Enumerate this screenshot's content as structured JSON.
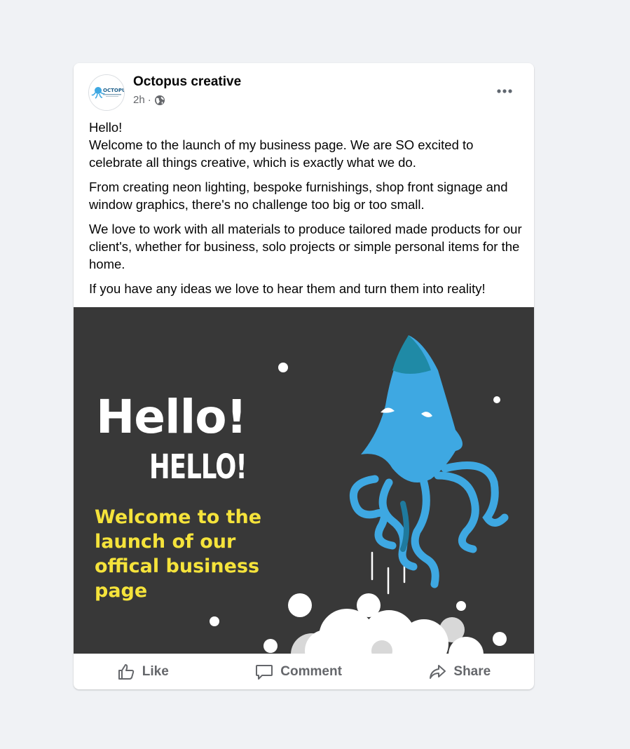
{
  "post": {
    "author": "Octopus creative",
    "avatar_text": "OCTOPUS",
    "time": "2h",
    "audience_icon": "globe-icon",
    "more_icon": "more-options-icon",
    "paragraphs": [
      "Hello!\nWelcome to the launch of my business page. We are SO excited to celebrate all things creative, which is exactly what we do.",
      "From creating neon lighting, bespoke furnishings, shop front signage and window graphics, there's no challenge too big or too small.",
      "We love to work with all materials to produce tailored made products for our client's, whether for business, solo projects or simple personal items for the home.",
      "If you have any ideas we love to hear them and turn them into reality!"
    ],
    "image": {
      "headline": "Hello!",
      "subheadline": "HELLO!",
      "tagline": "Welcome to the launch of our offical business page",
      "background_color": "#383838",
      "accent_color": "#f5e33b",
      "mascot": "octopus-rocket-illustration"
    }
  },
  "actions": {
    "like_label": "Like",
    "comment_label": "Comment",
    "share_label": "Share"
  },
  "colors": {
    "page_background": "#f0f2f5",
    "card_background": "#ffffff",
    "secondary_text": "#65676b",
    "octopus_blue": "#3ea8e2"
  }
}
